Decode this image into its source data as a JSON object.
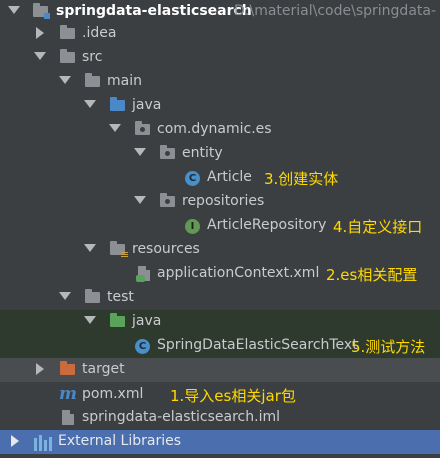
{
  "project": {
    "name": "springdata-elasticsearch",
    "path": "D:\\material\\code\\springdata-"
  },
  "tree": {
    "idea": ".idea",
    "src": "src",
    "main": "main",
    "java": "java",
    "package": "com.dynamic.es",
    "entity": "entity",
    "article": "Article",
    "repositories": "repositories",
    "article_repository": "ArticleRepository",
    "resources": "resources",
    "app_context": "applicationContext.xml",
    "test": "test",
    "test_java": "java",
    "test_class": "SpringDataElasticSearchText",
    "target": "target",
    "pom": "pom.xml",
    "iml": "springdata-elasticsearch.iml",
    "external_libs": "External Libraries"
  },
  "annotations": {
    "a1": "1.导入es相关jar包",
    "a2": "2.es相关配置",
    "a3": "3.创建实体",
    "a4": "4.自定义接口",
    "a5": "5.测试方法"
  },
  "colors": {
    "background": "#3c3f41",
    "selected_row": "#4b6eaf",
    "annotation": "#ffd900",
    "folder_source": "#4a88c7",
    "folder_test": "#5aa35a",
    "folder_target": "#c96b3e"
  },
  "icons": [
    "module-folder-icon",
    "folder-icon",
    "package-icon",
    "class-icon",
    "interface-icon",
    "xml-icon",
    "test-class-icon",
    "maven-icon",
    "iml-file-icon",
    "libraries-icon"
  ]
}
